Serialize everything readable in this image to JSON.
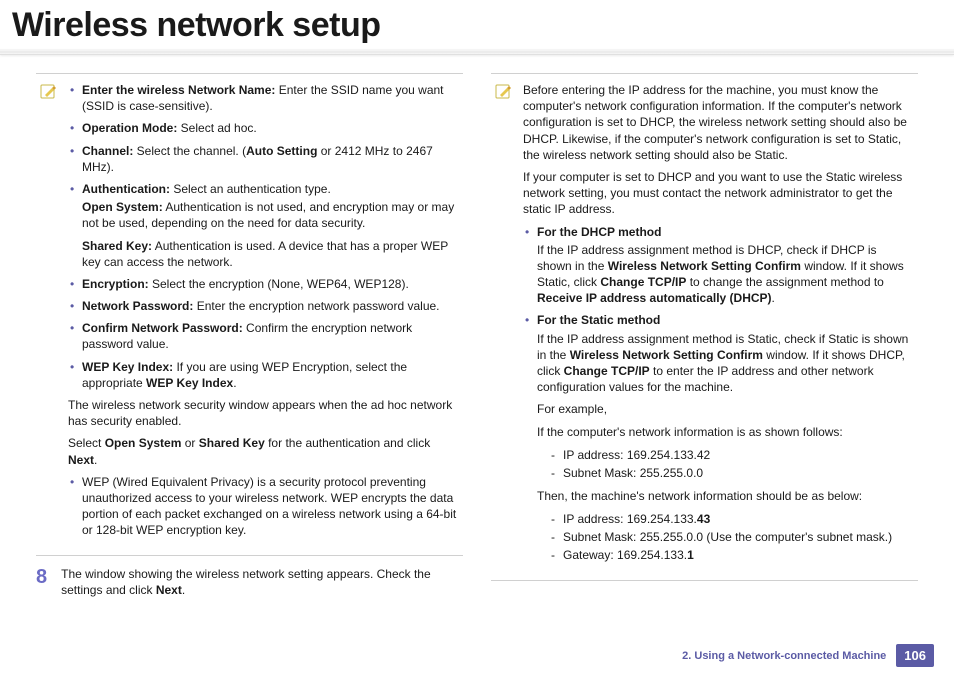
{
  "title": "Wireless network setup",
  "left": {
    "note_items": [
      {
        "label": "Enter the wireless Network Name:",
        "text": " Enter the SSID name you want (SSID is case-sensitive)."
      },
      {
        "label": "Operation Mode:",
        "text": " Select ad hoc."
      },
      {
        "label": "Channel:",
        "text": " Select the channel. (",
        "bold2": "Auto Setting",
        "tail": " or 2412 MHz to 2467 MHz)."
      },
      {
        "label": "Authentication:",
        "text": " Select an authentication type."
      }
    ],
    "auth_open_label": "Open System:",
    "auth_open_text": " Authentication is not used, and encryption may or may not be used, depending on the need for data security.",
    "auth_shared_label": "Shared Key:",
    "auth_shared_text": " Authentication is used. A device that has a proper WEP key can access the network.",
    "more_items": [
      {
        "label": "Encryption:",
        "text": " Select the encryption (None, WEP64, WEP128)."
      },
      {
        "label": "Network Password:",
        "text": " Enter the encryption network password value."
      },
      {
        "label": "Confirm Network Password:",
        "text": " Confirm the encryption network password value."
      },
      {
        "label": "WEP Key Index:",
        "text": " If you are using WEP Encryption, select the appropriate ",
        "bold2": "WEP Key Index",
        "tail": "."
      }
    ],
    "para1": "The wireless network security window appears when the ad hoc network has security enabled.",
    "para2_pre": "Select ",
    "para2_b1": "Open System",
    "para2_mid": " or ",
    "para2_b2": "Shared Key",
    "para2_post": " for the authentication and click ",
    "para2_b3": "Next",
    "para2_end": ".",
    "wep_bullet": "WEP (Wired Equivalent Privacy) is a security protocol preventing unauthorized access to your wireless network. WEP encrypts the data portion of each packet exchanged on a wireless network using a 64-bit or 128-bit WEP encryption key.",
    "step_num": "8",
    "step_text_pre": "The window showing the wireless network setting appears. Check the settings and click ",
    "step_text_b": "Next",
    "step_text_end": "."
  },
  "right": {
    "intro1": "Before entering the IP address for the machine, you must know the computer's network configuration information. If the computer's network configuration is set to DHCP, the wireless network setting should also be DHCP. Likewise, if the computer's network configuration is set to Static, the wireless network setting should also be Static.",
    "intro2": "If your computer is set to DHCP and you want to use the Static wireless network setting, you must contact the network administrator to get the static IP address.",
    "dhcp_heading": "For the DHCP method",
    "dhcp_pre": "If the IP address assignment method is DHCP, check if DHCP is shown in the ",
    "dhcp_b1": "Wireless Network Setting Confirm",
    "dhcp_mid": " window. If it shows Static, click ",
    "dhcp_b2": "Change TCP/IP",
    "dhcp_mid2": " to change the assignment method to ",
    "dhcp_b3": "Receive IP address automatically (DHCP)",
    "dhcp_end": ".",
    "static_heading": "For the Static method",
    "static_pre": "If the IP address assignment method is Static, check if Static is shown in the ",
    "static_b1": "Wireless Network Setting Confirm",
    "static_mid": " window. If it shows DHCP, click ",
    "static_b2": "Change TCP/IP",
    "static_end": " to enter the IP address and other network configuration values for the machine.",
    "for_example": "For example,",
    "example_intro": "If the computer's network information is as shown follows:",
    "ex_ip": "IP address: 169.254.133.42",
    "ex_mask": "Subnet Mask: 255.255.0.0",
    "then_line": "Then, the machine's network information should be as below:",
    "m_ip_pre": "IP address: 169.254.133.",
    "m_ip_b": "43",
    "m_mask": "Subnet Mask: 255.255.0.0 (Use the computer's subnet mask.)",
    "m_gw_pre": "Gateway: 169.254.133.",
    "m_gw_b": "1"
  },
  "footer": {
    "chapter": "2.  Using a Network-connected Machine",
    "page": "106"
  }
}
